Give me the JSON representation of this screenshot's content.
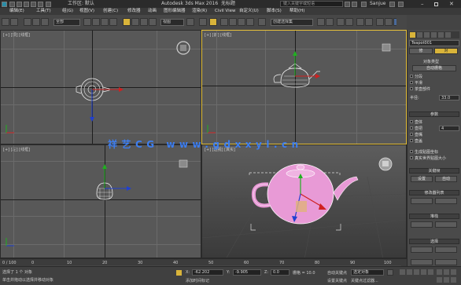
{
  "titlebar": {
    "app_title": "Autodesk 3ds Max 2016",
    "doc_title": "无标题",
    "workspace": "工作区: 默认",
    "search_placeholder": "键入关键字或短语",
    "user": "Sanjue"
  },
  "menu": [
    "编辑(E)",
    "工具(T)",
    "组(G)",
    "视图(V)",
    "创建(C)",
    "修改器",
    "动画",
    "图形编辑器",
    "渲染(R)",
    "Civil View",
    "自定义(U)",
    "脚本(S)",
    "帮助(H)"
  ],
  "toolbar": {
    "selection_filter": "全部",
    "ref_coord": "视图",
    "named_selection": "创建选择集"
  },
  "viewports": {
    "top_left": "[+] [顶] [线框]",
    "top_right": "[+] [前] [线框]",
    "bottom_left": "[+] [左] [线框]",
    "bottom_right": "[+] [透视] [真实]"
  },
  "watermark": "祥艺CG www.gdxxyl.cn",
  "command_panel": {
    "object_name": "Teapot001",
    "tabs": [
      "修",
      "对"
    ],
    "section_object_type": "对象类型",
    "autogrid": "自动栅格",
    "section_name_color": "名称和颜色",
    "rollout_params": "参数",
    "rollout_parameters": "参数",
    "segments_label": "分段",
    "smooth_label": "平滑",
    "teapot_parts": "茶壶部件",
    "body": "壶体",
    "handle": "壶把",
    "spout": "壶嘴",
    "lid": "壶盖",
    "gen_mapping": "生成贴图坐标",
    "real_world": "真实世界贴图大小",
    "radius_label": "半径:",
    "radius_value": "33.0",
    "segments_value": "4",
    "rollout_keyframe": "关键帧",
    "set_key": "设置",
    "auto_key": "自动",
    "rollout_modify": "修改器列表",
    "rollout_stack": "堆栈",
    "rollout_selection": "选择"
  },
  "timeline": {
    "frame_readout": "0 / 100",
    "ticks": [
      "0",
      "10",
      "20",
      "30",
      "40",
      "50",
      "60",
      "70",
      "80",
      "90",
      "100"
    ]
  },
  "status": {
    "selection": "选择了 1 个 对象",
    "prompt": "单击并拖动以选择并移动对象",
    "x_label": "X:",
    "x_value": "-62.202",
    "y_label": "Y:",
    "y_value": "-9.905",
    "z_label": "Z:",
    "z_value": "0.0",
    "grid": "栅格 = 10.0",
    "auto_key": "自动关键点",
    "selected": "选定对象",
    "set_key": "设置关键点",
    "key_filters": "关键点过滤器...",
    "add_time_tag": "添加时间标记",
    "welcome": "欢迎使用"
  },
  "colors": {
    "teapot_pink": "#e89ad6",
    "active_border": "#e8c23a",
    "axis_red": "#d02020",
    "axis_green": "#20b020",
    "axis_blue": "#2040d0",
    "watermark_blue": "#3d7ef0"
  }
}
